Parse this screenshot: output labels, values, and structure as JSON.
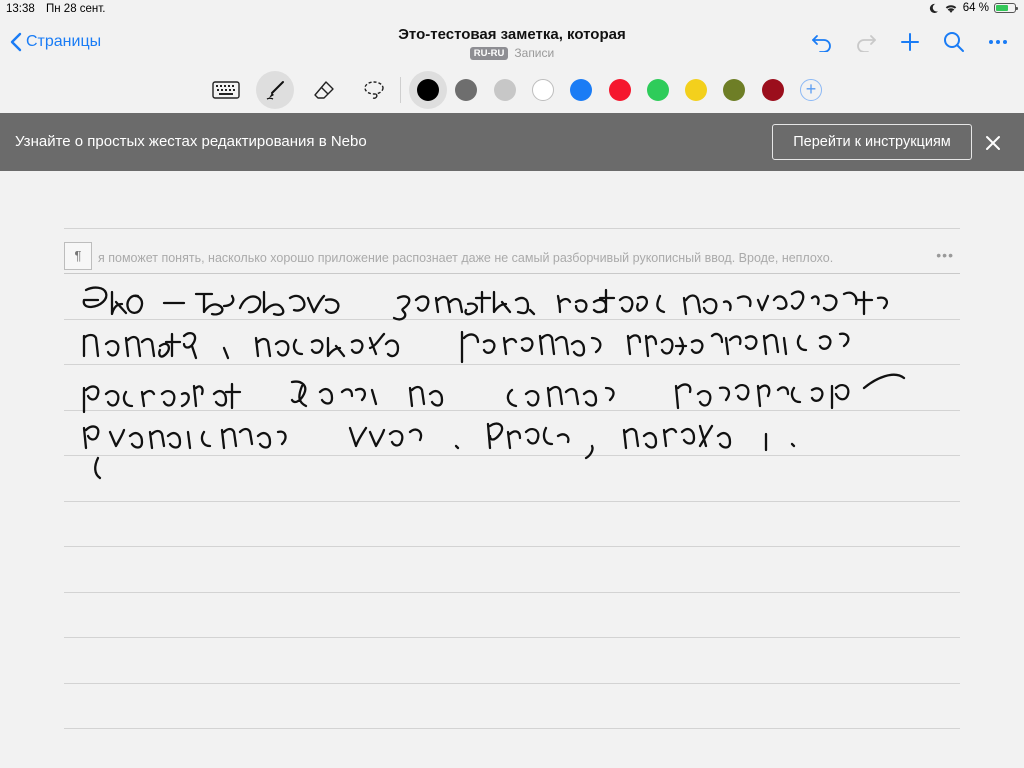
{
  "status_bar": {
    "time": "13:38",
    "date": "Пн 28 сент.",
    "battery": "64 %",
    "battery_level": 0.64,
    "battery_color": "#34c759"
  },
  "nav": {
    "back_label": "Страницы",
    "title": "Это-тестовая заметка, которая",
    "language_badge": "RU-RU",
    "folder": "Записи",
    "accent_color": "#1a7cf5",
    "actions": [
      "undo-icon",
      "redo-icon",
      "add-icon",
      "search-icon",
      "more-icon"
    ]
  },
  "toolbar": {
    "tools": [
      "keyboard-icon",
      "pen-icon",
      "eraser-icon",
      "lasso-icon"
    ],
    "active_tool": "pen-icon",
    "colors": [
      "#000000",
      "#6e6e6e",
      "#c7c7c7",
      "#ffffff",
      "#1a7cf5",
      "#f5172d",
      "#2ecc5a",
      "#f3d01c",
      "#6e7e26",
      "#9b0e1c"
    ],
    "selected_color": "#000000"
  },
  "banner": {
    "text": "Узнайте о простых жестах редактирования в Nebo",
    "button": "Перейти к инструкциям",
    "background": "#6b6b6b"
  },
  "paragraph": {
    "marker": "¶",
    "recognized_text": "я поможет понять, насколько хорошо приложение распознает даже не самый разборчивый рукописный ввод. Вроде, неплохо.",
    "more_label": "•••"
  },
  "handwriting": {
    "lines": [
      "Это - тестовая заметка, которая поможет",
      "понять, насколько хорошо приложение",
      "распознает даже не самый разборчивый",
      "рукописный ввод. Вроде, неплохо."
    ]
  }
}
